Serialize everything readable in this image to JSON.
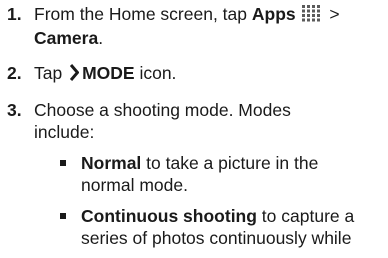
{
  "steps": [
    {
      "number": "1.",
      "pre": "From the Home screen, tap ",
      "apps_label": "Apps",
      "separator": ">",
      "camera_label": "Camera",
      "end": "."
    },
    {
      "number": "2.",
      "pre": "Tap",
      "mode_label": "MODE",
      "post": " icon."
    },
    {
      "number": "3.",
      "line1": "Choose a shooting mode. Modes",
      "line2": "include:"
    }
  ],
  "modes": [
    {
      "name": "Normal",
      "line1_rest": " to take a picture in the",
      "line2": "normal mode."
    },
    {
      "name": "Continuous shooting",
      "line1_rest": " to capture a",
      "line2": "series of photos continuously while"
    }
  ],
  "icons": {
    "apps": "apps-grid-icon",
    "mode": "chevron-right-icon"
  },
  "colors": {
    "text": "#1a1a1a"
  }
}
